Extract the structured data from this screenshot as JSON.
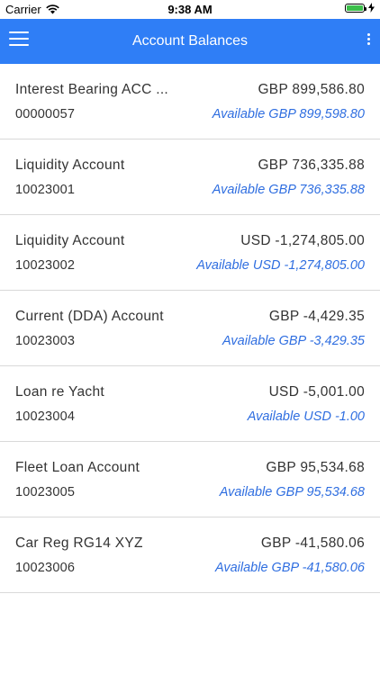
{
  "status_bar": {
    "carrier": "Carrier",
    "time": "9:38 AM",
    "battery_level": 1.0,
    "battery_color": "#3bbf4a"
  },
  "navbar": {
    "title": "Account Balances",
    "color": "#2f7ef6"
  },
  "accounts": [
    {
      "name": "Interest Bearing ACC ...",
      "number": "00000057",
      "balance": "GBP 899,586.80",
      "available": "Available GBP 899,598.80"
    },
    {
      "name": "Liquidity Account",
      "number": "10023001",
      "balance": "GBP 736,335.88",
      "available": "Available GBP 736,335.88"
    },
    {
      "name": "Liquidity Account",
      "number": "10023002",
      "balance": "USD -1,274,805.00",
      "available": "Available USD -1,274,805.00"
    },
    {
      "name": "Current (DDA) Account",
      "number": "10023003",
      "balance": "GBP -4,429.35",
      "available": "Available GBP -3,429.35"
    },
    {
      "name": "Loan re Yacht",
      "number": "10023004",
      "balance": "USD -5,001.00",
      "available": "Available USD -1.00"
    },
    {
      "name": "Fleet Loan Account",
      "number": "10023005",
      "balance": "GBP 95,534.68",
      "available": "Available GBP 95,534.68"
    },
    {
      "name": "Car Reg RG14 XYZ",
      "number": "10023006",
      "balance": "GBP -41,580.06",
      "available": "Available GBP -41,580.06"
    }
  ]
}
